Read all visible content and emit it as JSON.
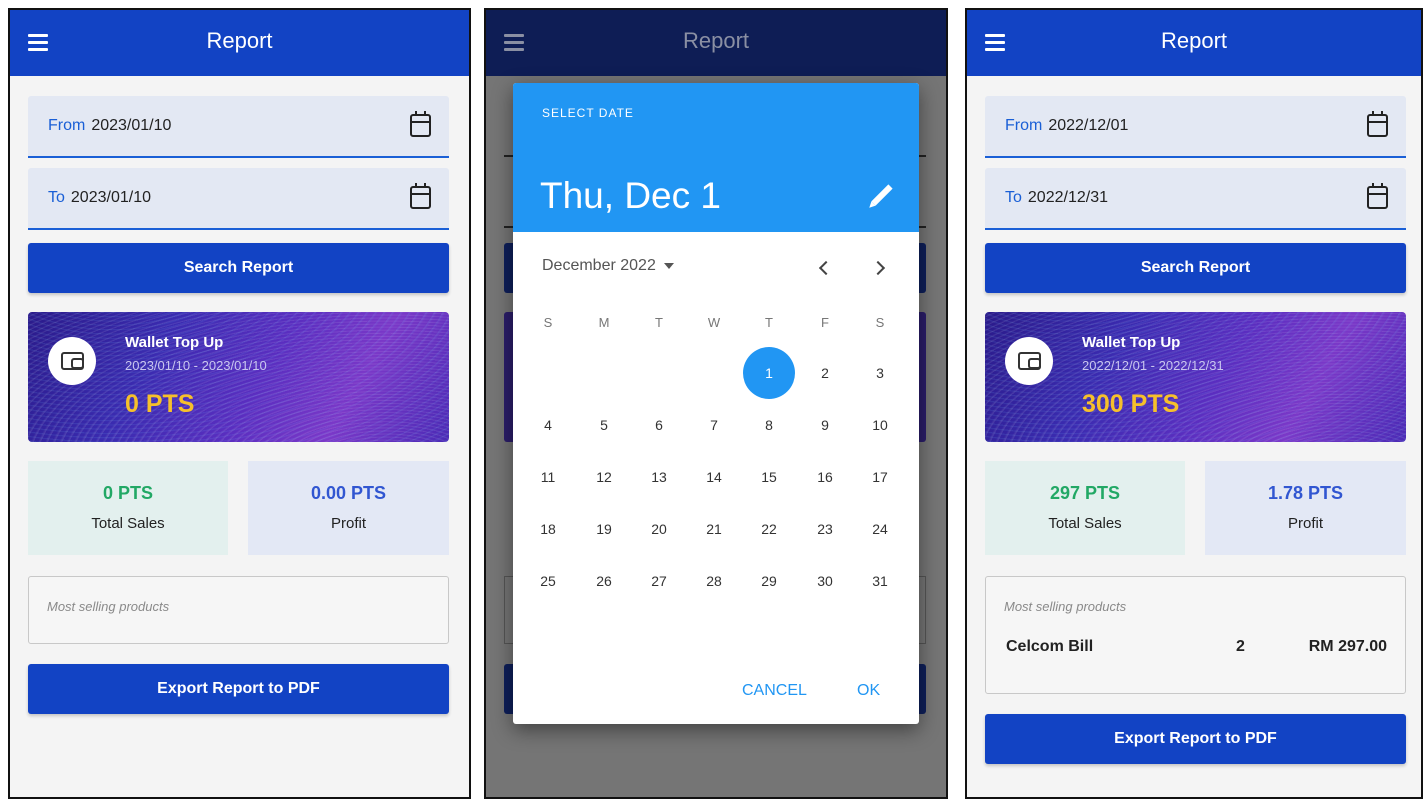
{
  "screen1": {
    "title": "Report",
    "from_label": "From",
    "from_value": "2023/01/10",
    "to_label": "To",
    "to_value": "2023/01/10",
    "search_label": "Search Report",
    "wallet_title": "Wallet Top Up",
    "wallet_range": "2023/01/10 - 2023/01/10",
    "wallet_points": "0 PTS",
    "sales_value": "0 PTS",
    "sales_label": "Total Sales",
    "profit_value": "0.00 PTS",
    "profit_label": "Profit",
    "most_selling_label": "Most selling products",
    "export_label": "Export Report to PDF"
  },
  "screen2": {
    "title": "Report",
    "dialog": {
      "header_label": "SELECT DATE",
      "selected_date": "Thu, Dec 1",
      "month_label": "December 2022",
      "weekdays": [
        "S",
        "M",
        "T",
        "W",
        "T",
        "F",
        "S"
      ],
      "selected_day": 1,
      "days": [
        "1",
        "2",
        "3",
        "4",
        "5",
        "6",
        "7",
        "8",
        "9",
        "10",
        "11",
        "12",
        "13",
        "14",
        "15",
        "16",
        "17",
        "18",
        "19",
        "20",
        "21",
        "22",
        "23",
        "24",
        "25",
        "26",
        "27",
        "28",
        "29",
        "30",
        "31"
      ],
      "cancel_label": "CANCEL",
      "ok_label": "OK"
    }
  },
  "screen3": {
    "title": "Report",
    "from_label": "From",
    "from_value": "2022/12/01",
    "to_label": "To",
    "to_value": "2022/12/31",
    "search_label": "Search Report",
    "wallet_title": "Wallet Top Up",
    "wallet_range": "2022/12/01 - 2022/12/31",
    "wallet_points": "300 PTS",
    "sales_value": "297 PTS",
    "sales_label": "Total Sales",
    "profit_value": "1.78 PTS",
    "profit_label": "Profit",
    "most_selling_label": "Most selling products",
    "products": [
      {
        "name": "Celcom Bill",
        "qty": "2",
        "amount": "RM 297.00"
      }
    ],
    "export_label": "Export Report to PDF"
  },
  "colors": {
    "app_bar": "#1243c4",
    "accent": "#1a5fd6",
    "picker_blue": "#2196f3",
    "points_gold": "#f6c02b",
    "sales_green": "#22a865",
    "profit_blue": "#3156d1"
  },
  "icons": [
    "menu-icon",
    "calendar-icon",
    "wallet-icon",
    "pencil-icon",
    "chevron-left-icon",
    "chevron-right-icon",
    "dropdown-arrow-icon"
  ]
}
